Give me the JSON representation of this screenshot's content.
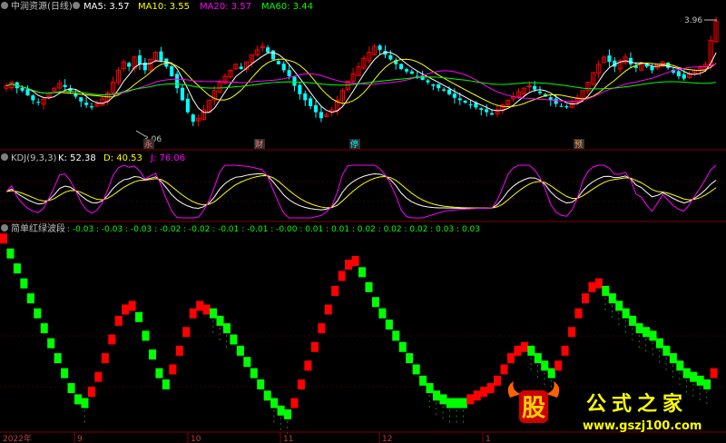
{
  "colors": {
    "bg": "#000000",
    "grid": "#800000",
    "up": "#ff0000",
    "down": "#00ffff",
    "ma5": "#ffffff",
    "ma10": "#ffff00",
    "ma20": "#ff00ff",
    "ma60": "#00ff00",
    "k": "#ffffff",
    "d": "#ffff00",
    "j": "#ff00ff",
    "wave_red": "#ff0000",
    "wave_green": "#00ff00"
  },
  "main_panel": {
    "title": "中润资源(日线)",
    "ma5_label": "MA5: 3.57",
    "ma10_label": "MA10: 3.55",
    "ma20_label": "MA20: 3.57",
    "ma60_label": "MA60: 3.44",
    "high_marker": "3.96",
    "low_marker": "3.06",
    "event_tags": [
      "永",
      "财",
      "停",
      "预"
    ]
  },
  "kdj_panel": {
    "title": "KDJ(9,3,3)",
    "k_label": "K: 52.38",
    "d_label": "D: 40.53",
    "j_label": "J: 76.06"
  },
  "wave_panel": {
    "title": "简单红绿波段",
    "values_text": ": -0.03 : -0.03 : -0.03 : -0.02 : -0.02 : -0.01 : -0.01 : -0.00 : 0.01 : 0.01 : 0.02 : 0.02 : 0.02 : 0.03 : 0.03"
  },
  "x_axis": {
    "labels": [
      "2022年",
      "9",
      "10",
      "11",
      "12",
      "1"
    ]
  },
  "watermark": {
    "logo_char": "股",
    "brand": "公式之家",
    "url": "www.gszj100.com"
  },
  "chart_data": [
    {
      "type": "candlestick",
      "title": "中润资源(日线)",
      "ylim": [
        3.0,
        4.0
      ],
      "marked_high": 3.96,
      "marked_low": 3.06,
      "close": [
        3.42,
        3.45,
        3.4,
        3.38,
        3.34,
        3.3,
        3.28,
        3.31,
        3.36,
        3.4,
        3.44,
        3.41,
        3.37,
        3.33,
        3.29,
        3.26,
        3.24,
        3.27,
        3.31,
        3.36,
        3.45,
        3.55,
        3.62,
        3.58,
        3.66,
        3.6,
        3.55,
        3.64,
        3.7,
        3.63,
        3.58,
        3.5,
        3.4,
        3.3,
        3.2,
        3.12,
        3.15,
        3.22,
        3.3,
        3.38,
        3.45,
        3.5,
        3.55,
        3.6,
        3.56,
        3.62,
        3.68,
        3.72,
        3.75,
        3.7,
        3.64,
        3.6,
        3.55,
        3.5,
        3.42,
        3.35,
        3.3,
        3.25,
        3.2,
        3.15,
        3.18,
        3.22,
        3.3,
        3.38,
        3.46,
        3.52,
        3.58,
        3.65,
        3.7,
        3.75,
        3.72,
        3.68,
        3.64,
        3.6,
        3.56,
        3.54,
        3.52,
        3.5,
        3.47,
        3.45,
        3.42,
        3.4,
        3.38,
        3.35,
        3.32,
        3.3,
        3.28,
        3.26,
        3.24,
        3.22,
        3.2,
        3.18,
        3.22,
        3.26,
        3.3,
        3.33,
        3.37,
        3.4,
        3.42,
        3.39,
        3.36,
        3.33,
        3.3,
        3.27,
        3.25,
        3.24,
        3.28,
        3.32,
        3.38,
        3.45,
        3.53,
        3.6,
        3.66,
        3.62,
        3.58,
        3.63,
        3.66,
        3.6,
        3.57,
        3.61,
        3.58,
        3.55,
        3.6,
        3.62,
        3.57,
        3.53,
        3.5,
        3.48,
        3.52,
        3.55,
        3.57,
        3.6,
        3.8,
        3.96
      ],
      "ma_series": [
        {
          "name": "MA5",
          "last": 3.57
        },
        {
          "name": "MA10",
          "last": 3.55
        },
        {
          "name": "MA20",
          "last": 3.57
        },
        {
          "name": "MA60",
          "last": 3.44
        }
      ]
    },
    {
      "type": "line",
      "title": "KDJ(9,3,3)",
      "ylim": [
        -10,
        110
      ],
      "series": [
        {
          "name": "K",
          "last": 52.38
        },
        {
          "name": "D",
          "last": 40.53
        },
        {
          "name": "J",
          "last": 76.06
        }
      ]
    },
    {
      "type": "bar",
      "title": "简单红绿波段",
      "ylim": [
        0,
        100
      ],
      "values": [
        96,
        88,
        80,
        72,
        64,
        56,
        48,
        40,
        32,
        24,
        16,
        10,
        8,
        14,
        22,
        32,
        42,
        52,
        58,
        60,
        54,
        44,
        34,
        24,
        18,
        26,
        36,
        46,
        56,
        60,
        58,
        56,
        52,
        48,
        42,
        36,
        30,
        24,
        18,
        12,
        8,
        4,
        2,
        8,
        18,
        28,
        38,
        48,
        58,
        68,
        76,
        82,
        84,
        78,
        70,
        62,
        56,
        50,
        44,
        38,
        32,
        26,
        20,
        16,
        12,
        10,
        8,
        8,
        8,
        10,
        12,
        14,
        16,
        20,
        26,
        32,
        36,
        38,
        36,
        32,
        28,
        24,
        28,
        36,
        46,
        56,
        64,
        70,
        72,
        68,
        64,
        60,
        56,
        52,
        48,
        46,
        44,
        40,
        36,
        32,
        28,
        24,
        22,
        20,
        18,
        24
      ],
      "states": [
        "R",
        "G",
        "G",
        "G",
        "G",
        "G",
        "G",
        "G",
        "G",
        "G",
        "G",
        "G",
        "G",
        "R",
        "R",
        "R",
        "R",
        "R",
        "R",
        "R",
        "G",
        "G",
        "G",
        "G",
        "G",
        "R",
        "R",
        "R",
        "R",
        "R",
        "R",
        "G",
        "G",
        "G",
        "G",
        "G",
        "G",
        "G",
        "G",
        "G",
        "G",
        "G",
        "G",
        "R",
        "R",
        "R",
        "R",
        "R",
        "R",
        "R",
        "R",
        "R",
        "R",
        "G",
        "G",
        "G",
        "G",
        "G",
        "G",
        "G",
        "G",
        "G",
        "G",
        "G",
        "G",
        "G",
        "G",
        "G",
        "G",
        "R",
        "R",
        "R",
        "R",
        "R",
        "R",
        "R",
        "R",
        "R",
        "G",
        "G",
        "G",
        "G",
        "R",
        "R",
        "R",
        "R",
        "R",
        "R",
        "R",
        "G",
        "G",
        "G",
        "G",
        "G",
        "G",
        "G",
        "G",
        "G",
        "G",
        "G",
        "G",
        "G",
        "G",
        "G",
        "G",
        "R"
      ]
    }
  ]
}
